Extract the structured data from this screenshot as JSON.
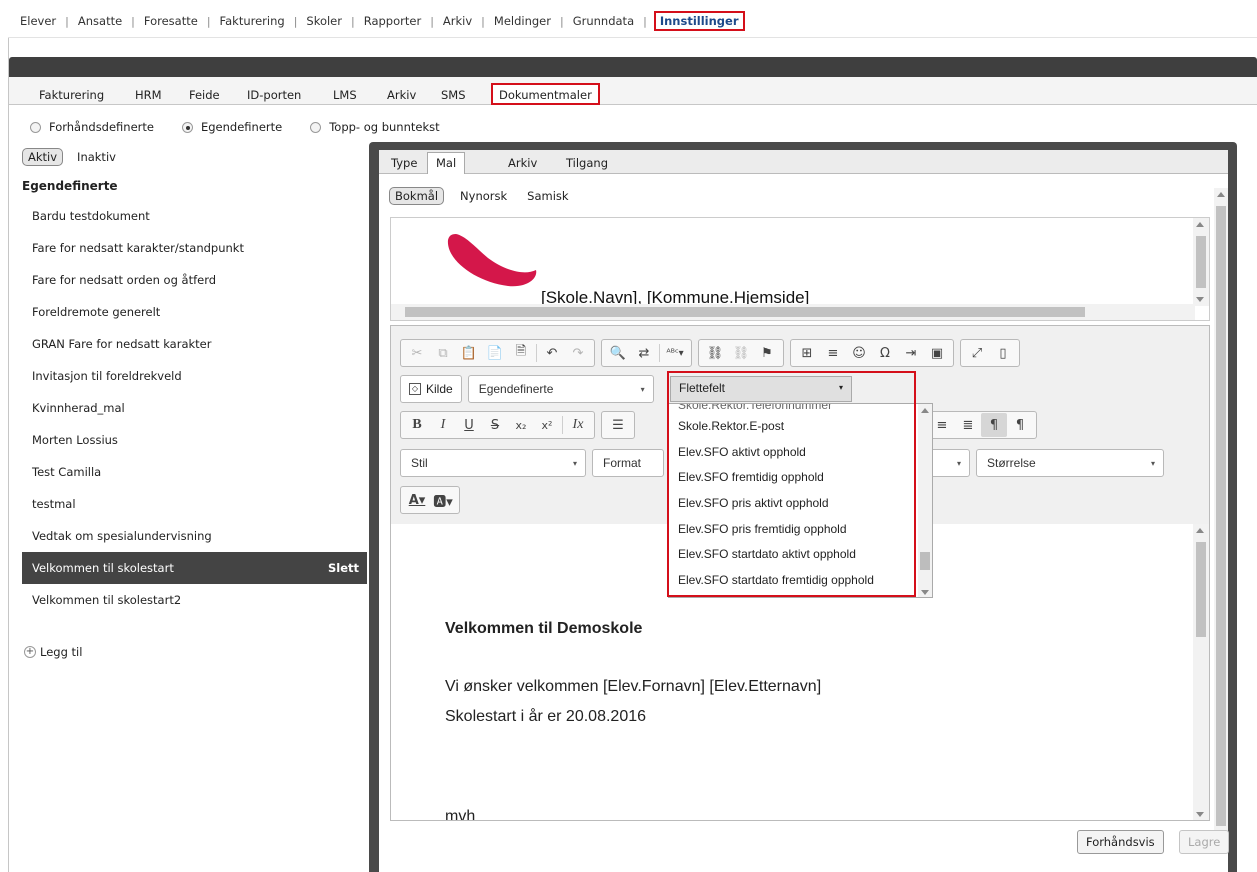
{
  "top_nav": {
    "items": [
      {
        "label": "Elever"
      },
      {
        "label": "Ansatte"
      },
      {
        "label": "Foresatte"
      },
      {
        "label": "Fakturering"
      },
      {
        "label": "Skoler"
      },
      {
        "label": "Rapporter"
      },
      {
        "label": "Arkiv"
      },
      {
        "label": "Meldinger"
      },
      {
        "label": "Grunndata"
      },
      {
        "label": "Innstillinger",
        "active": true
      }
    ]
  },
  "settings_tabs": [
    "Fakturering",
    "HRM",
    "Feide",
    "ID-porten",
    "LMS",
    "Arkiv",
    "SMS",
    "Dokumentmaler"
  ],
  "template_types": {
    "options": [
      "Forhåndsdefinerte",
      "Egendefinerte",
      "Topp- og bunntekst"
    ],
    "selected": "Egendefinerte"
  },
  "status_filter": {
    "active": "Aktiv",
    "inactive": "Inaktiv"
  },
  "left_list": {
    "heading": "Egendefinerte",
    "items": [
      "Bardu testdokument",
      "Fare for nedsatt karakter/standpunkt",
      "Fare for nedsatt orden og åtferd",
      "Foreldremote generelt",
      "GRAN Fare for nedsatt karakter",
      "Invitasjon til foreldrekveld",
      "Kvinnherad_mal",
      "Morten Lossius",
      "Test Camilla",
      "testmal",
      "Vedtak om spesialundervisning",
      "Velkommen til skolestart",
      "Velkommen til skolestart2"
    ],
    "selected": "Velkommen til skolestart",
    "delete_label": "Slett",
    "add_label": "Legg til"
  },
  "detail_tabs": [
    "Type",
    "Mal",
    "Arkiv",
    "Tilgang"
  ],
  "languages": [
    "Bokmål",
    "Nynorsk",
    "Samisk"
  ],
  "header_preview": {
    "text": "[Skole.Navn], [Kommune.Hjemside]",
    "logo_color": "#d4174a"
  },
  "toolbar": {
    "kilde_label": "Kilde",
    "template_combo": "Egendefinerte",
    "merge_combo": "Flettefelt",
    "style_combo": "Stil",
    "format_combo": "Format",
    "size_combo": "Størrelse"
  },
  "merge_fields": {
    "partial_top": "Skole.Rektor.Telefonnummer",
    "options": [
      "Skole.Rektor.E-post",
      "Elev.SFO aktivt opphold",
      "Elev.SFO fremtidig opphold",
      "Elev.SFO pris aktivt opphold",
      "Elev.SFO pris fremtidig opphold",
      "Elev.SFO startdato aktivt opphold",
      "Elev.SFO startdato fremtidig opphold"
    ]
  },
  "document": {
    "heading": "Velkommen til Demoskole",
    "line1": "Vi ønsker velkommen [Elev.Fornavn] [Elev.Etternavn]",
    "line2": "Skolestart i år er 20.08.2016",
    "line3": "mvh"
  },
  "actions": {
    "preview": "Forhåndsvis",
    "save": "Lagre"
  },
  "colors": {
    "highlight": "#d40f1a",
    "active_link": "#1d4a8a",
    "dark_bar": "#3f3f3f"
  }
}
